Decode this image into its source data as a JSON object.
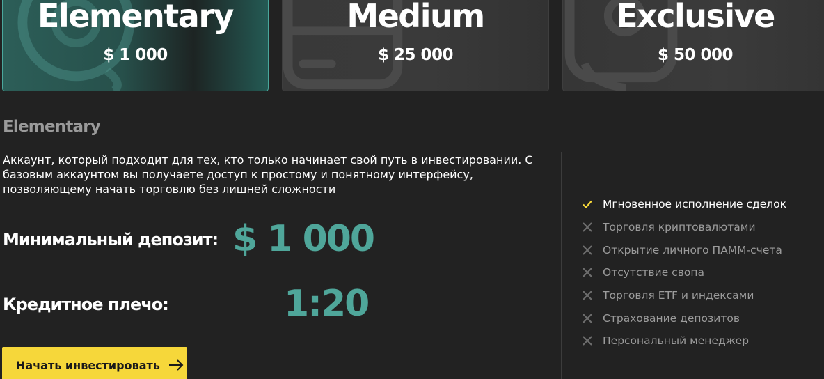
{
  "plans": [
    {
      "name": "Elementary",
      "price": "$ 1 000",
      "selected": true,
      "icon": "coin-icon"
    },
    {
      "name": "Medium",
      "price": "$ 25 000",
      "selected": false,
      "icon": "credit-card-icon"
    },
    {
      "name": "Exclusive",
      "price": "$ 50 000",
      "selected": false,
      "icon": "wallet-icon"
    }
  ],
  "detail": {
    "title": "Elementary",
    "description_lines": [
      "Аккаунт, который подходит для тех, кто только начинает свой путь в инвестировании. С",
      "базовым аккаунтом вы получаете доступ к простому и понятному интерфейсу,",
      "позволяющему начать торговлю без лишней сложности"
    ],
    "min_deposit_label": "Минимальный депозит:",
    "min_deposit_value": "$ 1 000",
    "leverage_label": "Кредитное плечо:",
    "leverage_value": "1:20",
    "cta_label": "Начать инвестировать"
  },
  "features": [
    {
      "label": "Мгновенное исполнение сделок",
      "included": true,
      "icon": "check-icon"
    },
    {
      "label": "Торговля криптовалютами",
      "included": false,
      "icon": "cross-icon"
    },
    {
      "label": "Открытие личного ПАММ-счета",
      "included": false,
      "icon": "cross-icon"
    },
    {
      "label": "Отсутствие свопа",
      "included": false,
      "icon": "cross-icon"
    },
    {
      "label": "Торговля ETF и индексами",
      "included": false,
      "icon": "cross-icon"
    },
    {
      "label": "Страхование депозитов",
      "included": false,
      "icon": "cross-icon"
    },
    {
      "label": "Персональный менеджер",
      "included": false,
      "icon": "cross-icon"
    }
  ],
  "colors": {
    "accent": "#4fa69a",
    "cta": "#f6d73a",
    "check": "#f6d73a",
    "cross": "#6e6e6e",
    "background": "#222222"
  }
}
